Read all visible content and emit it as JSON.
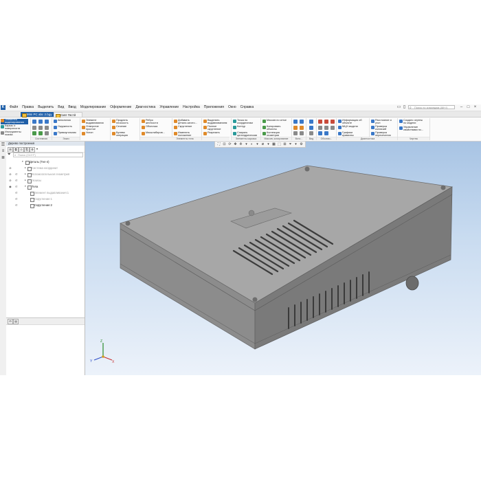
{
  "app": {
    "icon_letter": "K",
    "menu": [
      "Файл",
      "Правка",
      "Выделить",
      "Вид",
      "Ввод",
      "Моделирование",
      "Оформление",
      "Диагностика",
      "Управление",
      "Настройка",
      "Приложения",
      "Окно",
      "Справка"
    ],
    "search_placeholder": "Поиск по командам (Alt+/)",
    "window_controls": [
      "–",
      "□",
      "×"
    ]
  },
  "tabs": [
    {
      "label": "Mini PC abc 2.bgy",
      "close": "×",
      "active": true
    },
    {
      "label": "Сквт Гвстй",
      "close": "",
      "active": false
    }
  ],
  "toolbar": {
    "left_stack": [
      {
        "label": "Элементы\nмоделирования"
      },
      {
        "label": "Каркас и\nповерхности"
      },
      {
        "label": "Инструменты\nэскиза"
      }
    ],
    "groups": [
      {
        "label": "Системная",
        "items": []
      },
      {
        "label": "Эскиз",
        "items": [
          "Автолиния",
          "Окружность",
          "Прямоугольник"
        ]
      },
      {
        "label": "",
        "items": [
          "Элемент\nвыдавливания",
          "Отверстие\nпростое",
          "Уклон"
        ]
      },
      {
        "label": "",
        "items": [
          "Продлить\nплоскость",
          "Сечение",
          "Булева\nоперация"
        ]
      },
      {
        "label": "Элементы тела",
        "items": [
          "Ребро\nжесткости",
          "Оболочка",
          "Масштабиров..."
        ]
      },
      {
        "label": "",
        "items": [
          "Добавить\nдетали-загото...",
          "Скругление",
          "Изменить\nположение"
        ]
      },
      {
        "label": "",
        "items": [
          "Выделить\nвыдавливанием",
          "Полное\nскругление",
          "Разрезать"
        ]
      },
      {
        "label": "Элементы каркаса",
        "items": [
          "Точка по\nкоординатам",
          "Контур",
          "Спираль\nцилиндрическая"
        ]
      },
      {
        "label": "Массив, копирование",
        "items": [
          "Массив по сетке",
          "Копировать\nобъекты",
          "Коллекция\nгеометрии"
        ]
      },
      {
        "label": "Вспо...",
        "items": []
      },
      {
        "label": "Вид",
        "items": []
      },
      {
        "label": "Обознач...",
        "items": []
      },
      {
        "label": "Диагностика",
        "items": [
          "Информация об\nобъекте",
          "МЦХ модели",
          "Графики\nкривизны"
        ]
      },
      {
        "label": "",
        "items": [
          "Расстояние и\nугол",
          "Проверка\nколлизий",
          "Проверка\nпересечения"
        ]
      },
      {
        "label": "Чертеж",
        "items": [
          "Создать чертеж\nпо модели",
          "Управление\nсвойствами по..."
        ]
      }
    ]
  },
  "panel": {
    "title": "Дерево построения",
    "search_placeholder": "Поиск (Ctrl+F)",
    "tree": [
      {
        "label": "Деталь (Тел-4)",
        "dim": false,
        "level": 0
      },
      {
        "label": "Система координат",
        "dim": true,
        "level": 1
      },
      {
        "label": "Вспомогательная геометрия",
        "dim": true,
        "level": 1
      },
      {
        "label": "Эскизы",
        "dim": true,
        "level": 1
      },
      {
        "label": "Тела",
        "dim": false,
        "level": 1
      },
      {
        "label": "Элемент выдавливания:1",
        "dim": true,
        "level": 2
      },
      {
        "label": "Скругление:1",
        "dim": true,
        "level": 2
      },
      {
        "label": "Скругление:2",
        "dim": false,
        "level": 2
      }
    ]
  },
  "viewport": {
    "axes": {
      "x": "X",
      "y": "Y",
      "z": "Z"
    },
    "colors": {
      "background_top": "#a8c4e4",
      "background_bottom": "#ecf2fa",
      "model_top": "#a6a6a6",
      "model_front": "#8e8e8e",
      "model_side": "#7c7c7c"
    }
  }
}
